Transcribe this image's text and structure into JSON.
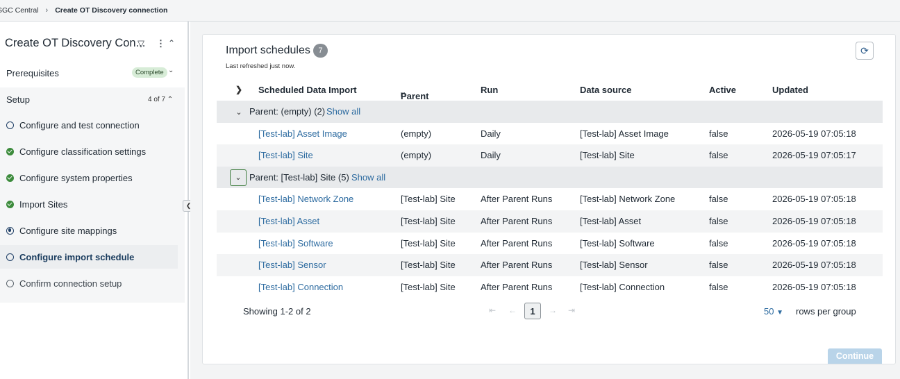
{
  "breadcrumb": {
    "root": "SGC Central",
    "current": "Create OT Discovery connection"
  },
  "sidebar": {
    "title": "Create OT Discovery Con...",
    "prerequisites": {
      "label": "Prerequisites",
      "badge": "Complete"
    },
    "setup": {
      "label": "Setup",
      "count": "4 of 7"
    },
    "steps": [
      {
        "label": "Configure and test connection",
        "status": "open"
      },
      {
        "label": "Configure classification settings",
        "status": "done"
      },
      {
        "label": "Configure system properties",
        "status": "done"
      },
      {
        "label": "Import Sites",
        "status": "done"
      },
      {
        "label": "Configure site mappings",
        "status": "partial"
      },
      {
        "label": "Configure import schedule",
        "status": "active"
      },
      {
        "label": "Confirm connection setup",
        "status": "todo"
      }
    ]
  },
  "main": {
    "title": "Import schedules",
    "count": "7",
    "refreshed": "Last refreshed just now.",
    "columns": [
      "Scheduled Data Import",
      "Parent",
      "Run",
      "Data source",
      "Active",
      "Updated"
    ],
    "groups": [
      {
        "label": "Parent: (empty) (2)",
        "show_all": "Show all",
        "rows": [
          [
            "[Test-lab] Asset Image",
            "(empty)",
            "Daily",
            "[Test-lab] Asset Image",
            "false",
            "2026-05-19 07:05:18"
          ],
          [
            "[Test-lab] Site",
            "(empty)",
            "Daily",
            "[Test-lab] Site",
            "false",
            "2026-05-19 07:05:17"
          ]
        ]
      },
      {
        "label": "Parent: [Test-lab] Site (5)",
        "show_all": "Show all",
        "rows": [
          [
            "[Test-lab] Network Zone",
            "[Test-lab] Site",
            "After Parent Runs",
            "[Test-lab] Network Zone",
            "false",
            "2026-05-19 07:05:18"
          ],
          [
            "[Test-lab] Asset",
            "[Test-lab] Site",
            "After Parent Runs",
            "[Test-lab] Asset",
            "false",
            "2026-05-19 07:05:18"
          ],
          [
            "[Test-lab] Software",
            "[Test-lab] Site",
            "After Parent Runs",
            "[Test-lab] Software",
            "false",
            "2026-05-19 07:05:18"
          ],
          [
            "[Test-lab] Sensor",
            "[Test-lab] Site",
            "After Parent Runs",
            "[Test-lab] Sensor",
            "false",
            "2026-05-19 07:05:18"
          ],
          [
            "[Test-lab] Connection",
            "[Test-lab] Site",
            "After Parent Runs",
            "[Test-lab] Connection",
            "false",
            "2026-05-19 07:05:18"
          ]
        ]
      }
    ],
    "pagination": {
      "showing": "Showing 1-2 of 2",
      "page": "1",
      "rows_per_group": "50",
      "rows_label": "rows per group"
    },
    "continue_label": "Continue"
  }
}
